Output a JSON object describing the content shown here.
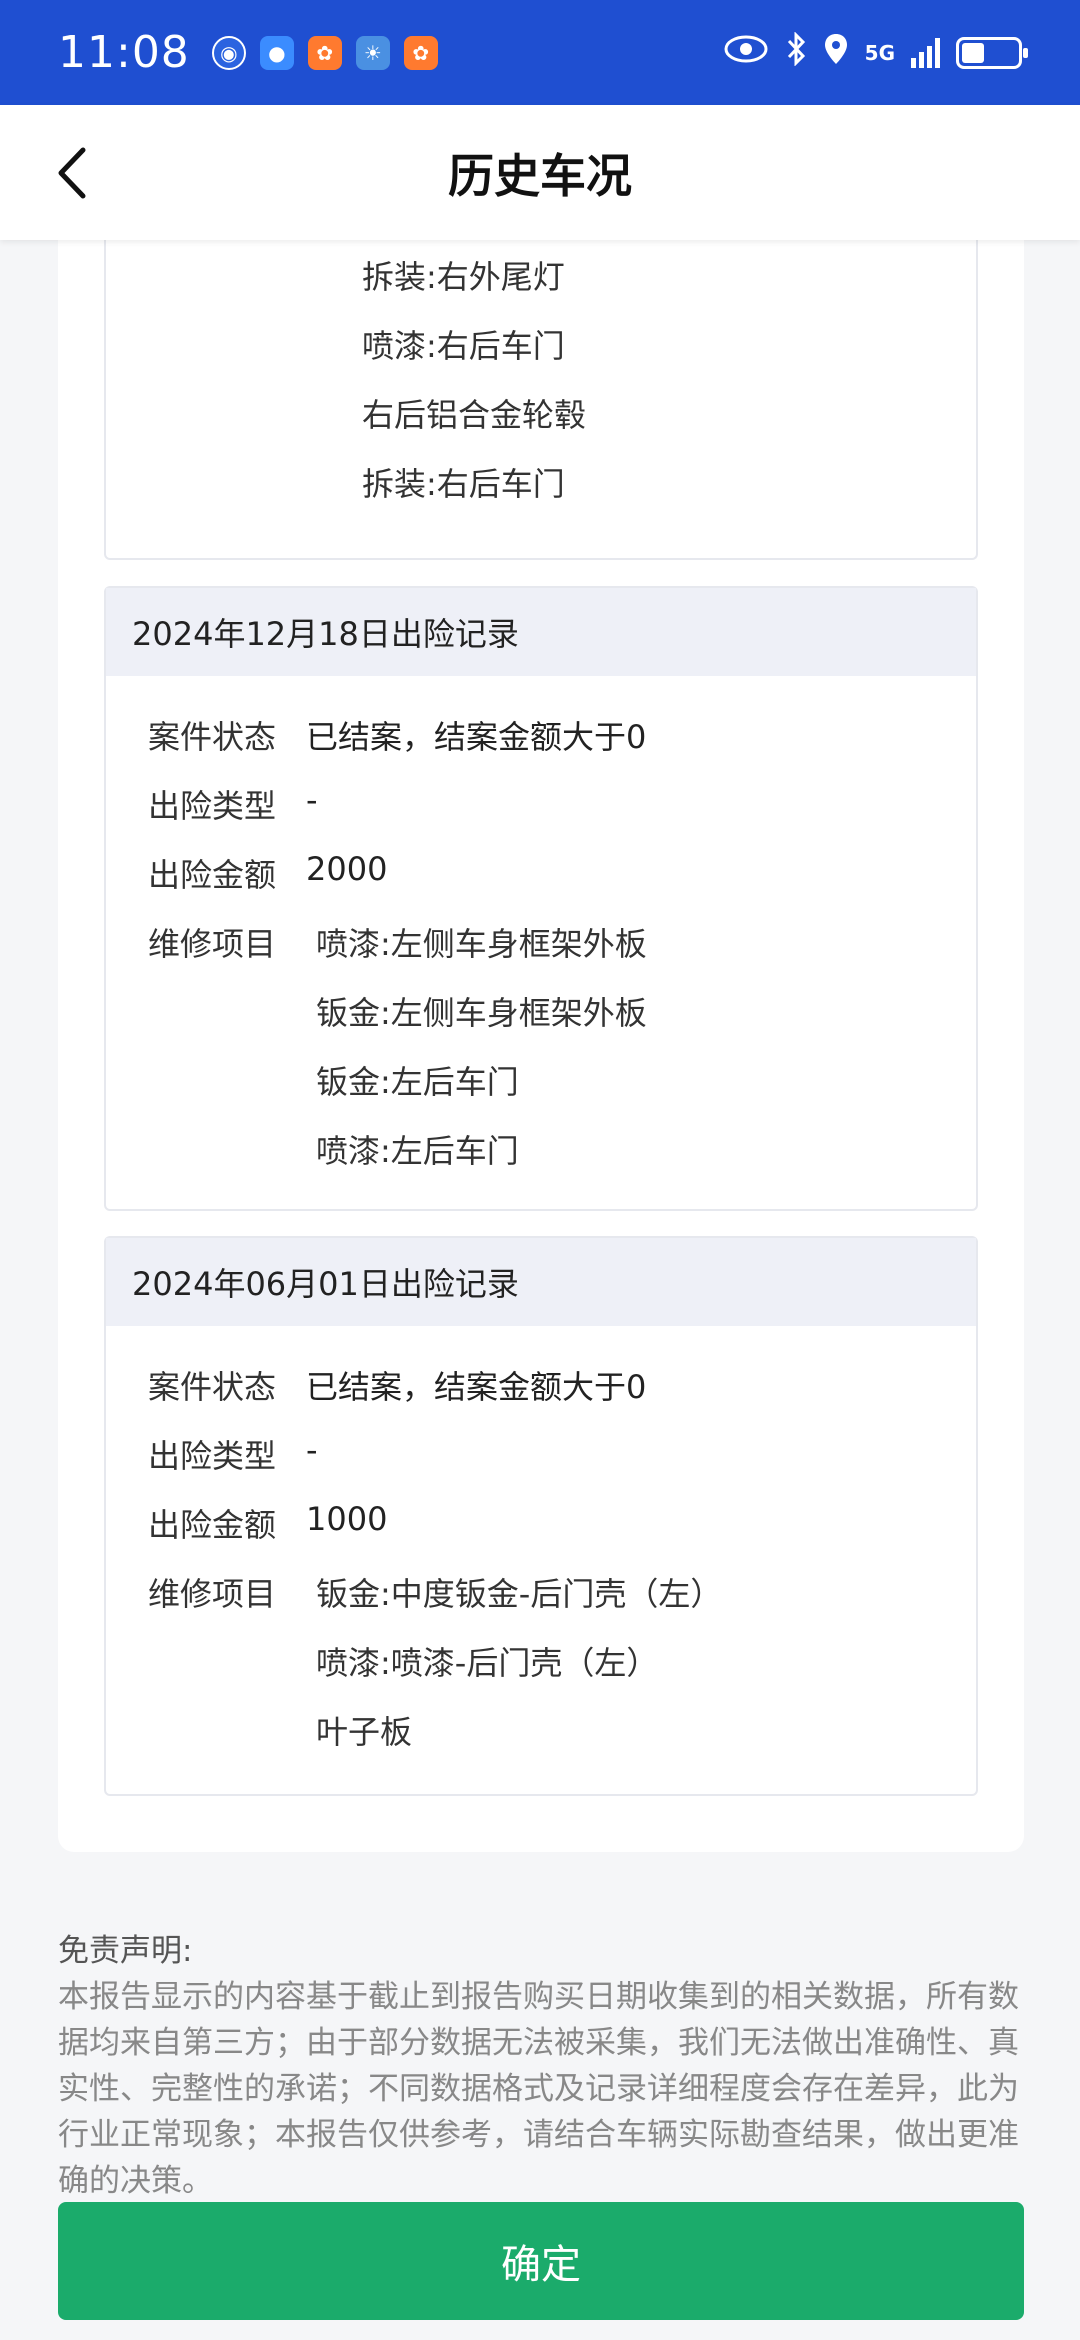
{
  "status_bar": {
    "time": "11:08",
    "network": "5G",
    "accent": "#1f4fd1"
  },
  "nav": {
    "title": "历史车况"
  },
  "top_card": {
    "items": [
      "拆装:右外尾灯",
      "喷漆:右后车门",
      "右后铝合金轮毂",
      "拆装:右后车门"
    ]
  },
  "records": [
    {
      "header": "2024年12月18日出险记录",
      "status_label": "案件状态",
      "status_value": "已结案，结案金额大于0",
      "type_label": "出险类型",
      "type_value": "-",
      "amount_label": "出险金额",
      "amount_value": "2000",
      "repair_label": "维修项目",
      "repair_items": [
        "喷漆:左侧车身框架外板",
        "钣金:左侧车身框架外板",
        "钣金:左后车门",
        "喷漆:左后车门"
      ]
    },
    {
      "header": "2024年06月01日出险记录",
      "status_label": "案件状态",
      "status_value": "已结案，结案金额大于0",
      "type_label": "出险类型",
      "type_value": "-",
      "amount_label": "出险金额",
      "amount_value": "1000",
      "repair_label": "维修项目",
      "repair_items": [
        "钣金:中度钣金-后门壳（左）",
        "喷漆:喷漆-后门壳（左）",
        "叶子板"
      ]
    }
  ],
  "disclaimer": {
    "title": "免责声明:",
    "text": "本报告显示的内容基于截止到报告购买日期收集到的相关数据，所有数据均来自第三方；由于部分数据无法被采集，我们无法做出准确性、真实性、完整性的承诺；不同数据格式及记录详细程度会存在差异，此为行业正常现象；本报告仅供参考，请结合车辆实际勘查结果，做出更准确的决策。"
  },
  "confirm_button": {
    "label": "确定",
    "color": "#1bab6b"
  }
}
